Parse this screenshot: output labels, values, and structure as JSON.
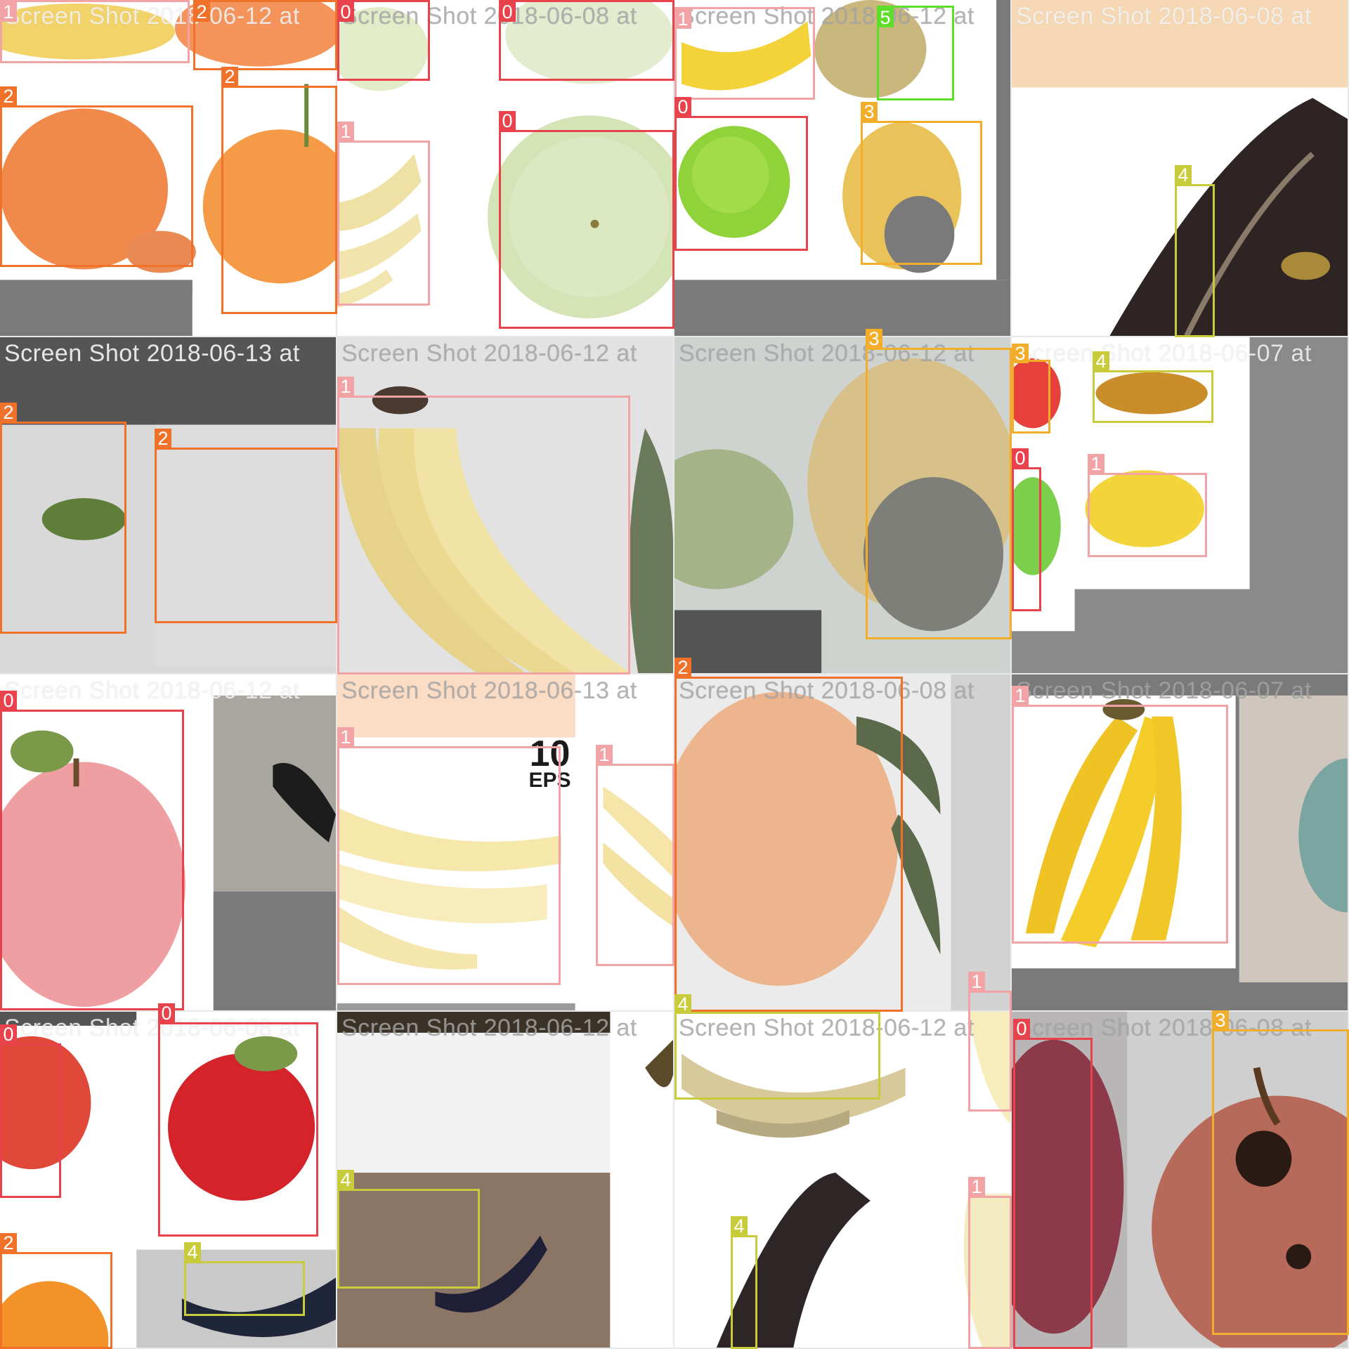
{
  "class_colors": {
    "0": "#e8424c",
    "1": "#f2a3a6",
    "2": "#f0722a",
    "3": "#f2ae2a",
    "4": "#c8cc3a",
    "5": "#5ede2a"
  },
  "captions": [
    "Screen Shot 2018-06-12 at",
    "Screen Shot 2018-06-08 at",
    "Screen Shot 2018-06-12 at",
    "Screen Shot 2018-06-08 at",
    "Screen Shot 2018-06-13 at",
    "Screen Shot 2018-06-12 at",
    "Screen Shot 2018-06-12 at",
    "Screen Shot 2018-06-07 at",
    "Screen Shot 2018-06-12 at",
    "Screen Shot 2018-06-13 at",
    "Screen Shot 2018-06-08 at",
    "Screen Shot 2018-06-07 at",
    "Screen Shot 2018-06-08 at",
    "Screen Shot 2018-06-12 at",
    "Screen Shot 2018-06-12 at",
    "Screen Shot 2018-06-08 at"
  ],
  "eps_badge": {
    "number": "10",
    "text": "EPS"
  },
  "labels": {
    "c0": "0",
    "c1": "1",
    "c2": "2",
    "c3": "3",
    "c4": "4",
    "c5": "5"
  }
}
